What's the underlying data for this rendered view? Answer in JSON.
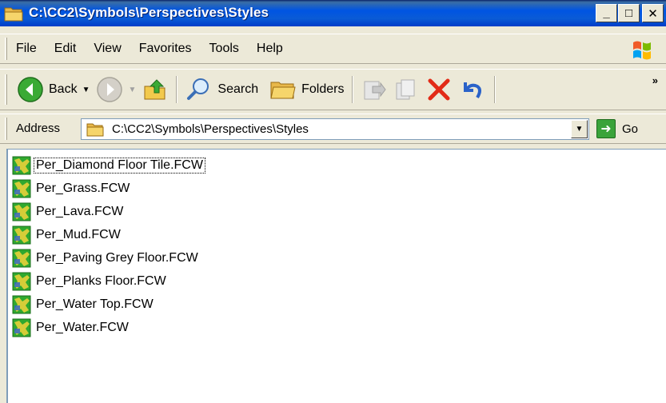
{
  "window": {
    "title": "C:\\CC2\\Symbols\\Perspectives\\Styles",
    "minimize_label": "_",
    "maximize_label": "□",
    "close_label": "✕"
  },
  "menu": [
    {
      "label": "File"
    },
    {
      "label": "Edit"
    },
    {
      "label": "View"
    },
    {
      "label": "Favorites"
    },
    {
      "label": "Tools"
    },
    {
      "label": "Help"
    }
  ],
  "toolbar": {
    "back_label": "Back",
    "search_label": "Search",
    "folders_label": "Folders",
    "overflow_label": "»"
  },
  "address": {
    "label": "Address",
    "value": "C:\\CC2\\Symbols\\Perspectives\\Styles",
    "go_label": "Go"
  },
  "files": [
    {
      "name": "Per_Diamond Floor Tile.FCW"
    },
    {
      "name": "Per_Grass.FCW"
    },
    {
      "name": "Per_Lava.FCW"
    },
    {
      "name": "Per_Mud.FCW"
    },
    {
      "name": "Per_Paving Grey Floor.FCW"
    },
    {
      "name": "Per_Planks Floor.FCW"
    },
    {
      "name": "Per_Water Top.FCW"
    },
    {
      "name": "Per_Water.FCW"
    }
  ],
  "colors": {
    "titlebar": "#0054e3",
    "selection_outline": "#000000",
    "icon_green": "#2fa82f",
    "icon_yellow": "#f2d43a"
  }
}
